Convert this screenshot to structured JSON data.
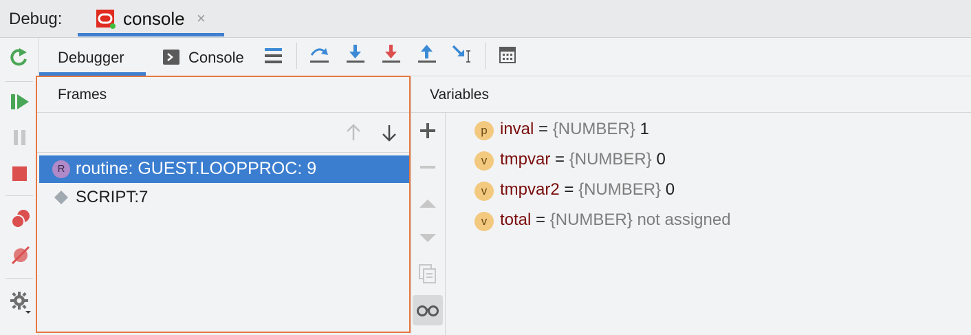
{
  "topbar": {
    "debug_label": "Debug:",
    "tab_label": "console",
    "close_glyph": "×"
  },
  "toolbar": {
    "tab_debugger": "Debugger",
    "tab_console": "Console"
  },
  "frames": {
    "title": "Frames",
    "items": [
      {
        "badge": "R",
        "label": "routine: GUEST.LOOPPROC: 9",
        "selected": true
      },
      {
        "badge": "diamond",
        "label": "SCRIPT:7",
        "selected": false
      }
    ]
  },
  "variables": {
    "title": "Variables",
    "items": [
      {
        "badge": "p",
        "name": "inval",
        "eq": "=",
        "type": "{NUMBER}",
        "value": "1"
      },
      {
        "badge": "v",
        "name": "tmpvar",
        "eq": "=",
        "type": "{NUMBER}",
        "value": "0"
      },
      {
        "badge": "v",
        "name": "tmpvar2",
        "eq": "=",
        "type": "{NUMBER}",
        "value": "0"
      },
      {
        "badge": "v",
        "name": "total",
        "eq": "=",
        "type": "{NUMBER}",
        "value": "not assigned"
      }
    ]
  },
  "colors": {
    "accent_blue": "#3f7fcf",
    "selection": "#3b7ed0",
    "highlight_border": "#e8773f",
    "variable_badge": "#f2c97e",
    "resume_green": "#4aa657",
    "stop_red": "#db4f4f",
    "step_blue": "#3b8ad6"
  }
}
